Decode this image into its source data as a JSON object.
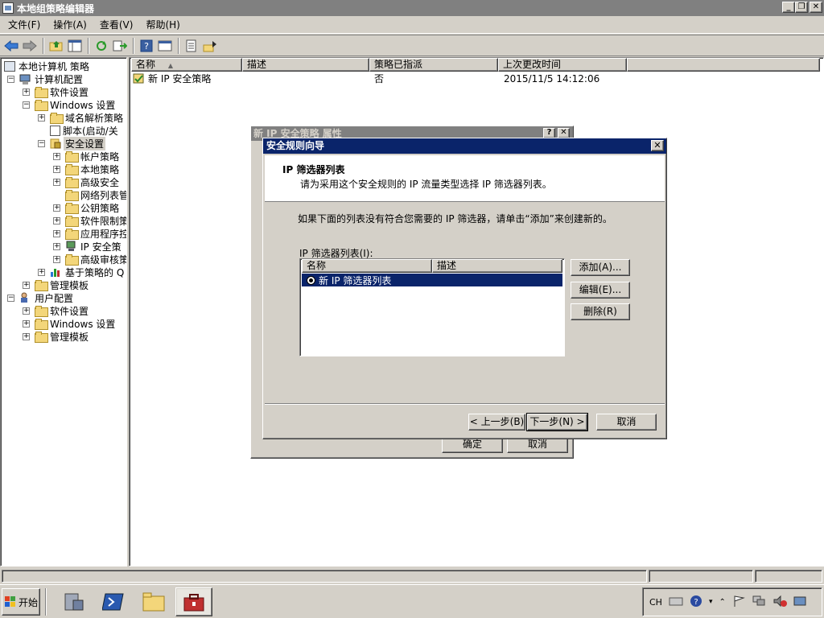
{
  "window": {
    "title": "本地组策略编辑器",
    "caption_buttons": [
      "_",
      "❐",
      "✕"
    ]
  },
  "menu": {
    "items": [
      "文件(F)",
      "操作(A)",
      "查看(V)",
      "帮助(H)"
    ]
  },
  "tree": {
    "root": "本地计算机 策略",
    "nodes": [
      {
        "label": "计算机配置"
      },
      {
        "label": "软件设置"
      },
      {
        "label": "Windows 设置"
      },
      {
        "label": "域名解析策略"
      },
      {
        "label": "脚本(启动/关"
      },
      {
        "label": "安全设置"
      },
      {
        "label": "帐户策略"
      },
      {
        "label": "本地策略"
      },
      {
        "label": "高级安全"
      },
      {
        "label": "网络列表管"
      },
      {
        "label": "公钥策略"
      },
      {
        "label": "软件限制策"
      },
      {
        "label": "应用程序控"
      },
      {
        "label": "IP 安全策"
      },
      {
        "label": "高级审核策"
      },
      {
        "label": "基于策略的 Q"
      },
      {
        "label": "管理模板"
      },
      {
        "label": "用户配置"
      },
      {
        "label": "软件设置"
      },
      {
        "label": "Windows 设置"
      },
      {
        "label": "管理模板"
      }
    ]
  },
  "list": {
    "columns": [
      "名称",
      "描述",
      "策略已指派",
      "上次更改时间"
    ],
    "rows": [
      {
        "name": "新 IP 安全策略",
        "description": "",
        "assigned": "否",
        "modified": "2015/11/5 14:12:06"
      }
    ]
  },
  "properties_dialog": {
    "title": "新 IP 安全策略 属性",
    "ok_label": "确定",
    "cancel_label": "取消"
  },
  "wizard": {
    "title": "安全规则向导",
    "heading": "IP 筛选器列表",
    "subheading": "请为采用这个安全规则的 IP 流量类型选择 IP 筛选器列表。",
    "instruction": "如果下面的列表没有符合您需要的 IP 筛选器，请单击“添加”来创建新的。",
    "list_label": "IP 筛选器列表(I):",
    "list_columns": [
      "名称",
      "描述"
    ],
    "list_items": [
      {
        "name": "新 IP 筛选器列表",
        "selected": true
      }
    ],
    "add_label": "添加(A)...",
    "edit_label": "编辑(E)...",
    "delete_label": "删除(R)",
    "back_label": "< 上一步(B)",
    "next_label": "下一步(N) >",
    "cancel_label": "取消"
  },
  "taskbar": {
    "start_label": "开始",
    "lang": "CH"
  },
  "colors": {
    "selection": "#0a246a",
    "inactive_title": "#808080",
    "face": "#d4d0c8"
  }
}
